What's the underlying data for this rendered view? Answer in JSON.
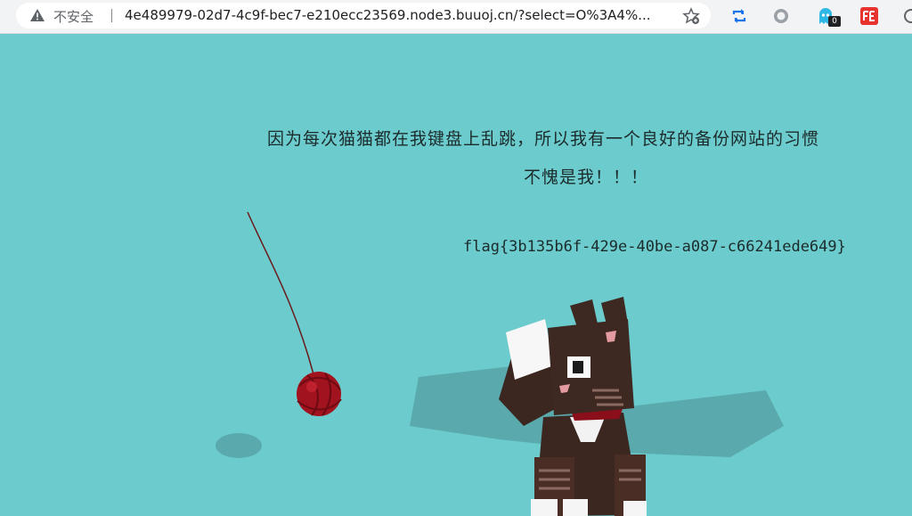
{
  "browser": {
    "security_label": "不安全",
    "url": "4e489979-02d7-4c9f-bec7-e210ecc23569.node3.buuoj.cn/?select=O%3A4%...",
    "extension_badge_count": "0",
    "icons": [
      "warning-icon",
      "bookmark-star-icon",
      "sync-extension-icon",
      "circle-extension-icon",
      "ghost-extension-icon",
      "fe-extension-icon",
      "more-extension-icon"
    ]
  },
  "page": {
    "message_line1": "因为每次猫猫都在我键盘上乱跳，所以我有一个良好的备份网站的习惯",
    "message_line2": "不愧是我！！！",
    "flag": "flag{3b135b6f-429e-40be-a087-c66241ede649}",
    "background_color": "#6ccbcd"
  }
}
